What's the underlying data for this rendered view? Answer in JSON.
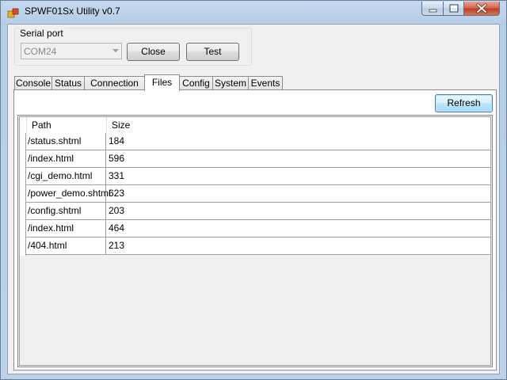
{
  "window": {
    "title": "SPWF01Sx Utility v0.7",
    "minimize_icon": "minimize-icon",
    "maximize_icon": "maximize-icon",
    "close_icon": "close-icon"
  },
  "serial_port": {
    "group_label": "Serial port",
    "port_value": "COM24",
    "close_label": "Close",
    "test_label": "Test"
  },
  "tabs": [
    {
      "label": "Console"
    },
    {
      "label": "Status"
    },
    {
      "label": "Connection"
    },
    {
      "label": "Files",
      "active": true
    },
    {
      "label": "Config"
    },
    {
      "label": "System"
    },
    {
      "label": "Events"
    }
  ],
  "files": {
    "refresh_label": "Refresh",
    "columns": [
      "Path",
      "Size"
    ],
    "rows": [
      {
        "path": "/status.shtml",
        "size": "184"
      },
      {
        "path": "/index.html",
        "size": "596"
      },
      {
        "path": "/cgi_demo.html",
        "size": "331"
      },
      {
        "path": "/power_demo.shtml",
        "size": "623"
      },
      {
        "path": "/config.shtml",
        "size": "203"
      },
      {
        "path": "/index.html",
        "size": "464"
      },
      {
        "path": "/404.html",
        "size": "213"
      }
    ]
  },
  "colors": {
    "title_bar": "#bcd2ea",
    "close_button": "#c0391f",
    "refresh_border": "#3c7fb1"
  }
}
